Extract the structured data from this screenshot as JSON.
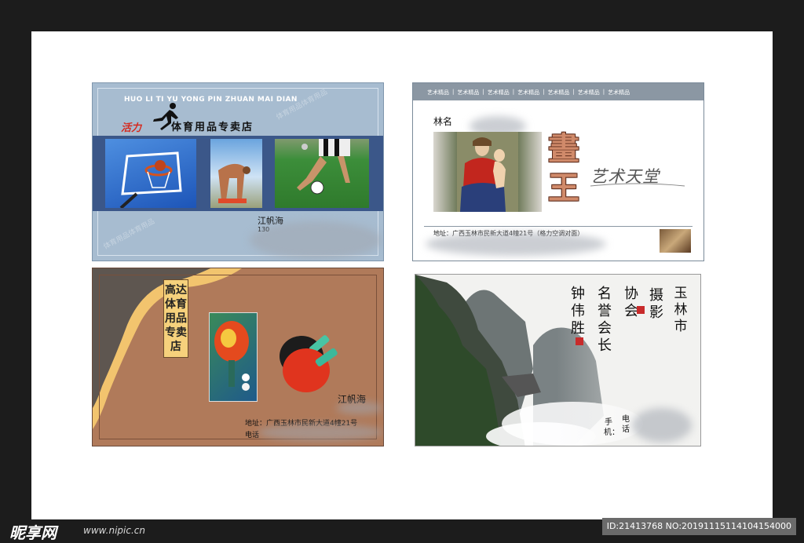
{
  "card1": {
    "pinyin": "HUO LI TI YU YONG PIN ZHUAN MAI DIAN",
    "brand": "活力",
    "shop_name": "体育用品专卖店",
    "contact_name": "江帆海",
    "phone_partial": "130",
    "watermark": "体育用品体育用品",
    "colors": {
      "background": "#a7bcd0",
      "band": "#3b5789",
      "brand": "#d52a1f"
    }
  },
  "card2": {
    "tag": "艺术精品",
    "tags": [
      "艺术精品",
      "艺术精品",
      "艺术精品",
      "艺术精品",
      "艺术精品",
      "艺术精品",
      "艺术精品"
    ],
    "owner": "林名",
    "big_chars": [
      "畫",
      "王"
    ],
    "slogan": "艺术天堂",
    "address": "地址：广西玉林市民新大道4幢21号（格力空调对面）"
  },
  "card3": {
    "vertical_title": "高达体育用品专卖店",
    "contact_name": "江帆海",
    "address": "地址：广西玉林市民新大道4幢21号",
    "tel_label": "电话"
  },
  "card4": {
    "col1": "玉林市",
    "col2": "摄影",
    "col3": "协会",
    "col4": "名誉会长",
    "col5": "钟伟胜",
    "tel_labels": {
      "phone": "电话",
      "mobile": "手机："
    }
  },
  "footer": {
    "logo": "昵享网",
    "logo_url": "www.nipic.cn",
    "id_line": "ID:21413768 NO:20191115114104154000"
  }
}
